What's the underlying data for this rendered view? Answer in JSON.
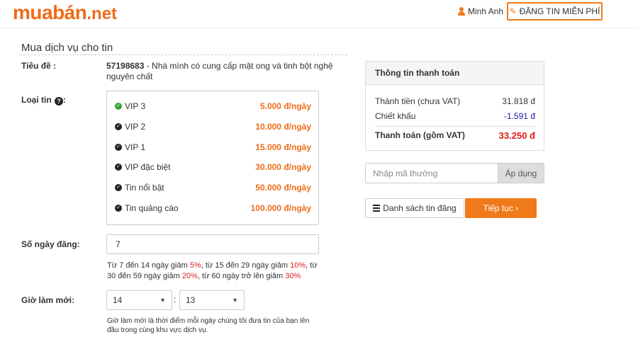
{
  "header": {
    "logo_part1": "muabán",
    "logo_part2": ".net",
    "user_name": "Minh Anh",
    "post_button": "ĐĂNG TIN MIỄN PHÍ"
  },
  "section_title": "Mua dịch vụ cho tin",
  "title_row": {
    "label": "Tiêu đề :",
    "id": "57198683",
    "text": " - Nhà mình có cung cấp mật ong và tinh bột nghệ nguyên chất"
  },
  "type_row": {
    "label": "Loại tin",
    "options": [
      {
        "name": "VIP 3",
        "price": "5.000 đ/ngày",
        "selected": true
      },
      {
        "name": "VIP 2",
        "price": "10.000 đ/ngày",
        "selected": false
      },
      {
        "name": "VIP 1",
        "price": "15.000 đ/ngày",
        "selected": false
      },
      {
        "name": "VIP đặc biệt",
        "price": "30.000 đ/ngày",
        "selected": false
      },
      {
        "name": "Tin nổi bật",
        "price": "50.000 đ/ngày",
        "selected": false
      },
      {
        "name": "Tin quảng cáo",
        "price": "100.000 đ/ngày",
        "selected": false
      }
    ]
  },
  "days_row": {
    "label": "Số ngày đăng:",
    "value": "7",
    "note": {
      "t1": "Từ 7 đến 14 ngày giảm ",
      "p1": "5%",
      "t2": ", từ 15 đến 29 ngày giảm ",
      "p2": "10%",
      "t3": ", từ 30 đến 59 ngày giảm ",
      "p3": "20%",
      "t4": ", từ 60 ngày trở lên giảm ",
      "p4": "30%"
    }
  },
  "refresh_row": {
    "label": "Giờ làm mới:",
    "hour": "14",
    "minute": "13",
    "separator": ":",
    "note": "Giờ làm mới là thời điểm mỗi ngày chúng tôi đưa tin của bạn lên đầu trong cùng khu vực dịch vụ."
  },
  "payment": {
    "title": "Thông tin thanh toán",
    "subtotal_label": "Thành tiền (chưa VAT)",
    "subtotal_value": "31.818 đ",
    "discount_label": "Chiết khấu",
    "discount_value": "-1.591 đ",
    "total_label": "Thanh toán (gồm VAT)",
    "total_value": "33.250 đ"
  },
  "promo": {
    "placeholder": "Nhập mã thưởng",
    "apply_label": "Áp dụng"
  },
  "actions": {
    "list_label": "Danh sách tin đăng",
    "next_label": "Tiếp tục ›"
  },
  "colors": {
    "accent": "#f07a1a",
    "selected_check": "#3aa53a",
    "total_red": "#e01b1b",
    "discount_blue": "#1a1aa6"
  },
  "icons": [
    "user-icon",
    "pencil-icon",
    "help-icon",
    "check-circle-icon",
    "chevron-down-icon",
    "list-icon"
  ]
}
